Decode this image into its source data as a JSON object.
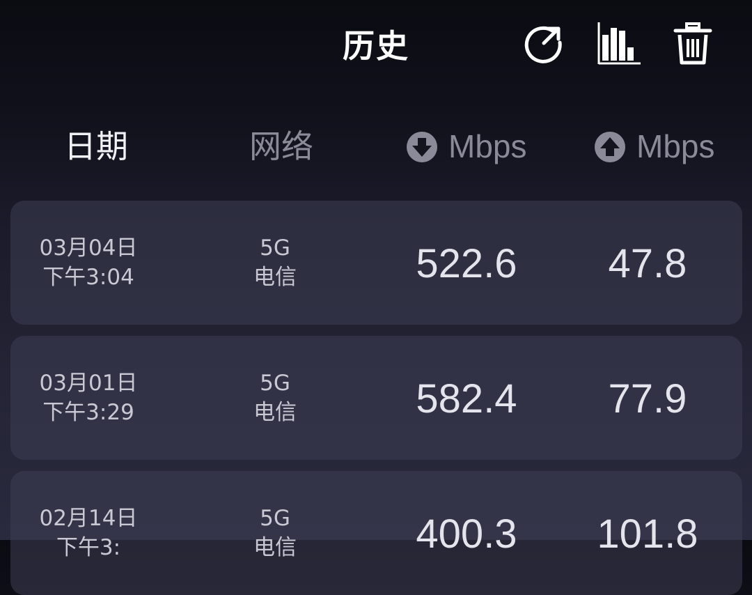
{
  "header": {
    "title": "历史",
    "icons": [
      "refresh-icon",
      "bar-chart-icon",
      "trash-icon"
    ]
  },
  "columns": {
    "date": "日期",
    "network": "网络",
    "download_unit": "Mbps",
    "upload_unit": "Mbps",
    "download_icon": "download-arrow-circle-icon",
    "upload_icon": "upload-arrow-circle-icon"
  },
  "rows": [
    {
      "date": "03月04日",
      "time": "下午3:04",
      "network_type": "5G",
      "carrier": "电信",
      "download": "522.6",
      "upload": "47.8"
    },
    {
      "date": "03月01日",
      "time": "下午3:29",
      "network_type": "5G",
      "carrier": "电信",
      "download": "582.4",
      "upload": "77.9"
    },
    {
      "date": "02月14日",
      "time": "下午3:",
      "network_type": "5G",
      "carrier": "电信",
      "download": "400.3",
      "upload": "101.8"
    }
  ],
  "colors": {
    "background_top": "#0b0b12",
    "background_bottom": "#2a2a3e",
    "row_bg": "#32324a",
    "active_header": "#f2f2f6",
    "inactive_header": "#8a8a98"
  }
}
